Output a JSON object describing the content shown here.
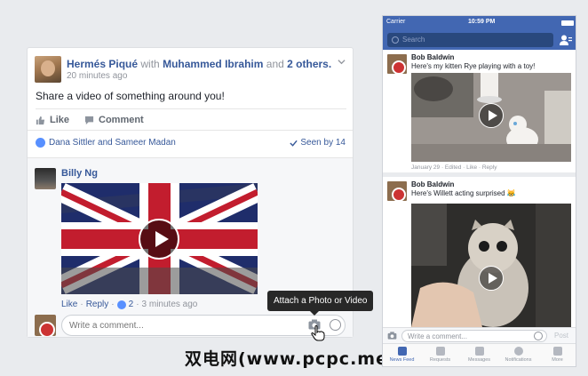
{
  "desktop_post": {
    "author": "Hermés Piqué",
    "with_text": "with",
    "tagged": "Muhammed Ibrahim",
    "and_text": "and",
    "others": "2 others.",
    "timestamp": "20 minutes ago",
    "text": "Share a video of something around you!",
    "like_label": "Like",
    "comment_label": "Comment",
    "likes_text": "Dana Sittler and Sameer Madan",
    "seen_text": "Seen by 14",
    "comment": {
      "author": "Billy Ng",
      "like_label": "Like",
      "reply_label": "Reply",
      "like_count": "2",
      "time": "3 minutes ago"
    },
    "comment_placeholder": "Write a comment...",
    "tooltip": "Attach a Photo or Video"
  },
  "watermark": "双电网(www.pcpc.me)",
  "phone": {
    "status": {
      "carrier": "Carrier",
      "time": "10:59 PM"
    },
    "search_placeholder": "Search",
    "stories": [
      {
        "author": "Bob Baldwin",
        "text": "Here's my kitten Rye playing with a toy!",
        "meta": "January 29 · Edited · Like · Reply"
      },
      {
        "author": "Bob Baldwin",
        "text": "Here's Willett acting surprised 😹"
      }
    ],
    "comment_placeholder": "Write a comment...",
    "post_label": "Post",
    "tabs": [
      {
        "label": "News Feed",
        "icon": "news-feed-icon"
      },
      {
        "label": "Requests",
        "icon": "friend-requests-icon"
      },
      {
        "label": "Messages",
        "icon": "messages-icon"
      },
      {
        "label": "Notifications",
        "icon": "globe-icon"
      },
      {
        "label": "More",
        "icon": "menu-icon"
      }
    ]
  },
  "colors": {
    "brand": "#4267b2",
    "link": "#365899",
    "like_blue": "#5890ff"
  }
}
